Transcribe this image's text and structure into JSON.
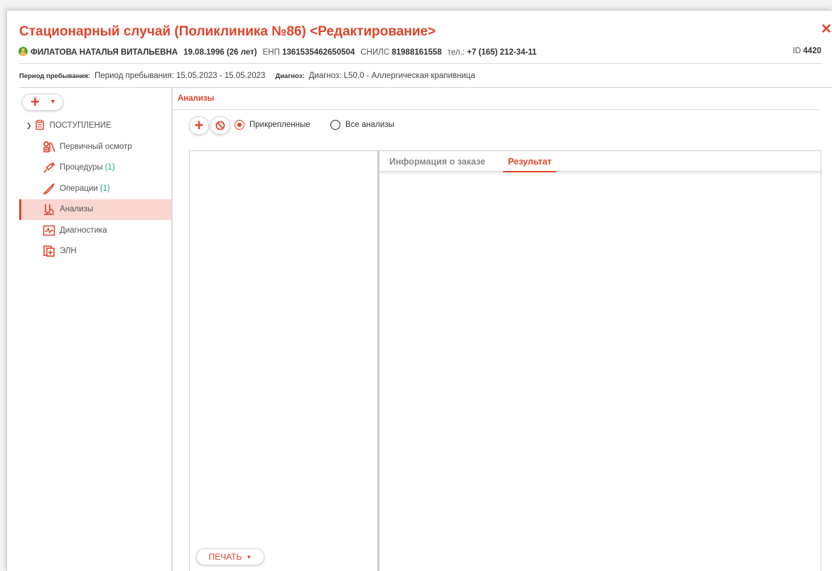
{
  "window": {
    "title": "Стационарный случай (Поликлиника №86) <Редактирование>",
    "close_icon": "close-icon"
  },
  "patient": {
    "name": "ФИЛАТОВА НАТАЛЬЯ ВИТАЛЬЕВНА",
    "birth": "19.08.1996 (26 лет)",
    "enp_label": "ЕНП",
    "enp": "1361535462650504",
    "snils_label": "СНИЛС",
    "snils": "81988161558",
    "phone_label": "тел.:",
    "phone": "+7 (165) 212-34-11",
    "id_label": "ID",
    "id": "4420"
  },
  "stay": {
    "period_label": "Период пребывания:",
    "period_value": "Период пребывания: 15.05.2023 - 15.05.2023",
    "diag_label": "Диагноз:",
    "diag_value": "Диагноз: L50.0 - Аллергическая крапивница"
  },
  "sidebar": {
    "add_button": "+",
    "group": "ПОСТУПЛЕНИЕ",
    "items": [
      {
        "label": "Первичный осмотр",
        "count": "",
        "icon": "exam-icon"
      },
      {
        "label": "Процедуры",
        "count": "(1)",
        "icon": "syringe-icon"
      },
      {
        "label": "Операции",
        "count": "(1)",
        "icon": "scalpel-icon"
      },
      {
        "label": "Анализы",
        "count": "",
        "icon": "lab-icon",
        "active": true
      },
      {
        "label": "Диагностика",
        "count": "",
        "icon": "ecg-icon"
      },
      {
        "label": "ЭЛН",
        "count": "",
        "icon": "sick-leave-icon"
      }
    ]
  },
  "main": {
    "section_title": "Анализы",
    "radio_attached": "Прикрепленные",
    "radio_all": "Все анализы",
    "print_button": "ПЕЧАТЬ",
    "tabs": [
      "Информация о заказе",
      "Результат"
    ]
  },
  "colors": {
    "accent": "#e0442c",
    "count_green": "#1ba87a",
    "active_row": "#f9d7d0"
  }
}
